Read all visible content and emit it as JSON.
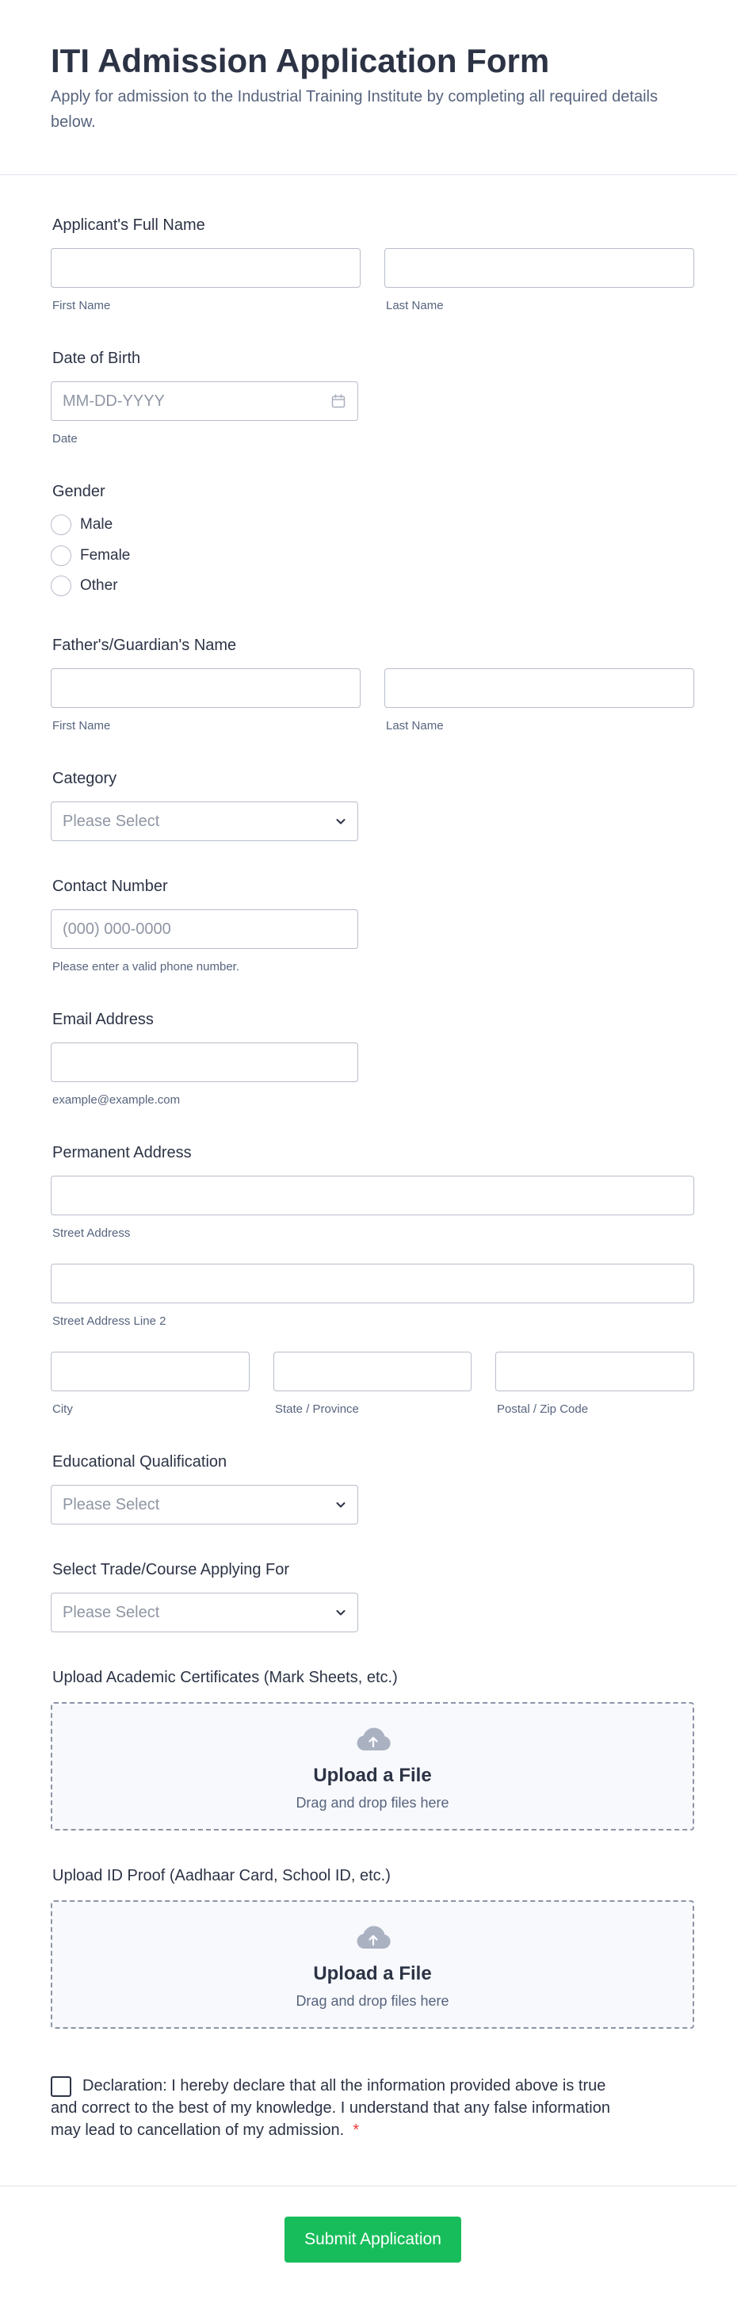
{
  "header": {
    "title": "ITI Admission Application Form",
    "subtitle": "Apply for admission to the Industrial Training Institute by completing all required details below."
  },
  "applicant_name": {
    "label": "Applicant's Full Name",
    "first_sublabel": "First Name",
    "last_sublabel": "Last Name"
  },
  "dob": {
    "label": "Date of Birth",
    "placeholder": "MM-DD-YYYY",
    "sublabel": "Date"
  },
  "gender": {
    "label": "Gender",
    "options": [
      "Male",
      "Female",
      "Other"
    ]
  },
  "guardian_name": {
    "label": "Father's/Guardian's Name",
    "first_sublabel": "First Name",
    "last_sublabel": "Last Name"
  },
  "category": {
    "label": "Category",
    "placeholder": "Please Select"
  },
  "contact": {
    "label": "Contact Number",
    "placeholder": "(000) 000-0000",
    "sublabel": "Please enter a valid phone number."
  },
  "email": {
    "label": "Email Address",
    "sublabel": "example@example.com"
  },
  "address": {
    "label": "Permanent Address",
    "street_sublabel": "Street Address",
    "street2_sublabel": "Street Address Line 2",
    "city_sublabel": "City",
    "state_sublabel": "State / Province",
    "zip_sublabel": "Postal / Zip Code"
  },
  "qualification": {
    "label": "Educational Qualification",
    "placeholder": "Please Select"
  },
  "trade": {
    "label": "Select Trade/Course Applying For",
    "placeholder": "Please Select"
  },
  "upload_certificates": {
    "label": "Upload Academic Certificates (Mark Sheets, etc.)",
    "title": "Upload a File",
    "subtitle": "Drag and drop files here"
  },
  "upload_id": {
    "label": "Upload ID Proof (Aadhaar Card, School ID, etc.)",
    "title": "Upload a File",
    "subtitle": "Drag and drop files here"
  },
  "declaration": {
    "text": "Declaration: I hereby declare that all the information provided above is true and correct to the best of my knowledge. I understand that any false information may lead to cancellation of my admission.",
    "required_mark": "*"
  },
  "submit": {
    "label": "Submit Application"
  },
  "colors": {
    "primary_text": "#2c3345",
    "secondary_text": "#57647e",
    "submit_button": "#18bd5b",
    "required": "#f23a3c",
    "input_border": "#b8bdc9"
  }
}
